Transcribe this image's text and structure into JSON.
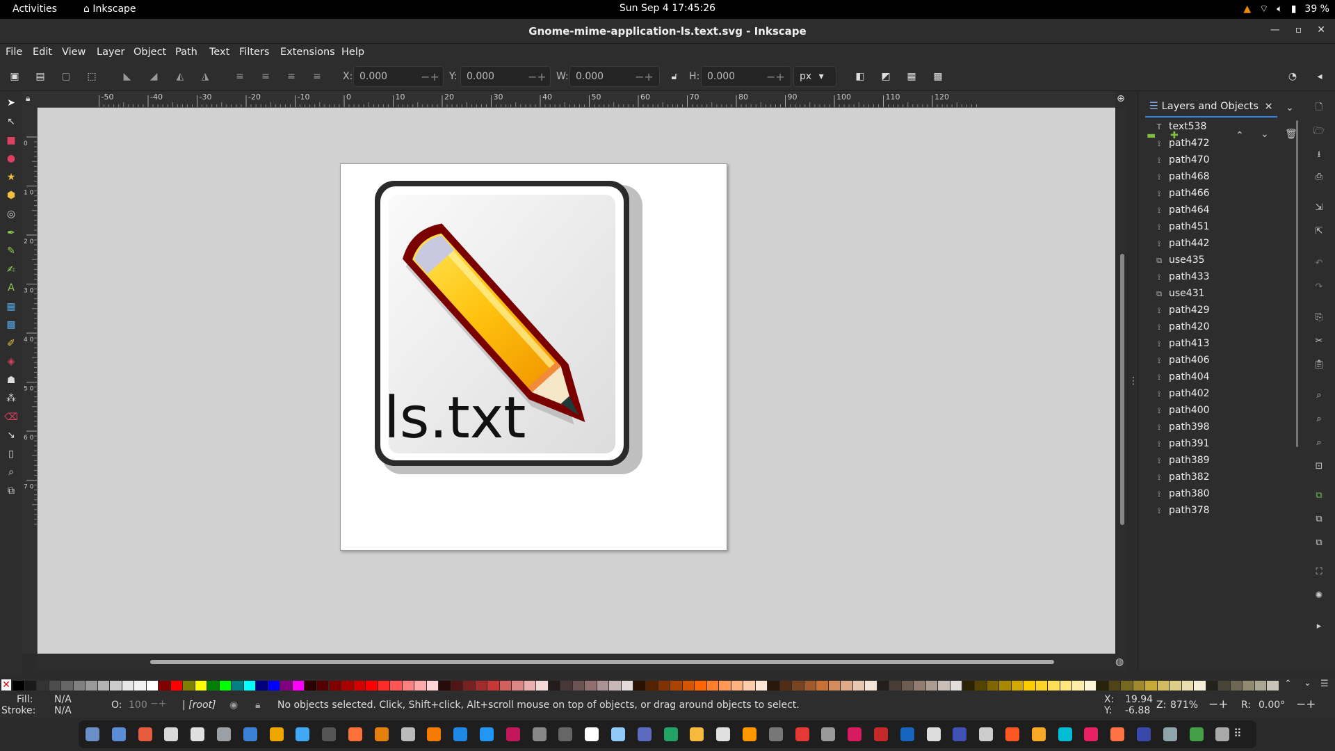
{
  "topbar": {
    "activities": "Activities",
    "app_name": "Inkscape",
    "clock": "Sun Sep 4  17:45:26",
    "battery": "39 %"
  },
  "window": {
    "title": "Gnome-mime-application-ls.text.svg - Inkscape"
  },
  "menu": [
    "File",
    "Edit",
    "View",
    "Layer",
    "Object",
    "Path",
    "Text",
    "Filters",
    "Extensions",
    "Help"
  ],
  "toolbar": {
    "x_label": "X:",
    "x_value": "0.000",
    "y_label": "Y:",
    "y_value": "0.000",
    "w_label": "W:",
    "w_value": "0.000",
    "h_label": "H:",
    "h_value": "0.000",
    "unit": "px"
  },
  "ruler": {
    "h_ticks": [
      "-50",
      "-40",
      "-30",
      "-20",
      "-10",
      "0",
      "10",
      "20",
      "30",
      "40",
      "50",
      "60",
      "70",
      "80",
      "90",
      "100",
      "110",
      "120"
    ],
    "v_ticks": [
      "0",
      "1\n0",
      "2\n0",
      "3\n0",
      "4\n0",
      "5\n0",
      "6\n0",
      "7\n0"
    ]
  },
  "drawing": {
    "text": "ls.txt",
    "colors": {
      "frame": "#2b2b2b",
      "pencil_body": "#ffc20e",
      "pencil_outline": "#7a0000",
      "tip": "#f5e6c8",
      "lead": "#1e3a3a"
    }
  },
  "dock": {
    "tab_label": "Layers and Objects",
    "items": [
      {
        "name": "text538",
        "icon": "text-icon"
      },
      {
        "name": "path472",
        "icon": "path-icon"
      },
      {
        "name": "path470",
        "icon": "path-icon"
      },
      {
        "name": "path468",
        "icon": "path-icon"
      },
      {
        "name": "path466",
        "icon": "path-icon"
      },
      {
        "name": "path464",
        "icon": "path-icon"
      },
      {
        "name": "path451",
        "icon": "path-icon"
      },
      {
        "name": "path442",
        "icon": "path-icon"
      },
      {
        "name": "use435",
        "icon": "clone-icon"
      },
      {
        "name": "path433",
        "icon": "path-icon"
      },
      {
        "name": "use431",
        "icon": "clone-icon"
      },
      {
        "name": "path429",
        "icon": "path-icon"
      },
      {
        "name": "path420",
        "icon": "path-icon"
      },
      {
        "name": "path413",
        "icon": "path-icon"
      },
      {
        "name": "path406",
        "icon": "path-icon"
      },
      {
        "name": "path404",
        "icon": "path-icon"
      },
      {
        "name": "path402",
        "icon": "path-icon"
      },
      {
        "name": "path400",
        "icon": "path-icon"
      },
      {
        "name": "path398",
        "icon": "path-icon"
      },
      {
        "name": "path391",
        "icon": "path-icon"
      },
      {
        "name": "path389",
        "icon": "path-icon"
      },
      {
        "name": "path382",
        "icon": "path-icon"
      },
      {
        "name": "path380",
        "icon": "path-icon"
      },
      {
        "name": "path378",
        "icon": "path-icon"
      }
    ]
  },
  "status": {
    "fill_label": "Fill:",
    "fill_value": "N/A",
    "stroke_label": "Stroke:",
    "stroke_value": "N/A",
    "opacity_label": "O:",
    "opacity_value": "100",
    "layer": "[root]",
    "message": "No objects selected. Click, Shift+click, Alt+scroll mouse on top of objects, or drag around objects to select.",
    "x_label": "X:",
    "x_value": "19.94",
    "y_label": "Y:",
    "y_value": "-6.88",
    "zoom_label": "Z:",
    "zoom_value": "871%",
    "rotate_label": "R:",
    "rotate_value": "0.00°"
  },
  "palette": [
    "#000000",
    "#1a1a1a",
    "#333333",
    "#4d4d4d",
    "#666666",
    "#808080",
    "#999999",
    "#b3b3b3",
    "#cccccc",
    "#e6e6e6",
    "#f2f2f2",
    "#ffffff",
    "#800000",
    "#ff0000",
    "#808000",
    "#ffff00",
    "#008000",
    "#00ff00",
    "#008080",
    "#00ffff",
    "#000080",
    "#0000ff",
    "#800080",
    "#ff00ff",
    "#2b0000",
    "#550000",
    "#800000",
    "#aa0000",
    "#d40000",
    "#ff0000",
    "#ff2a2a",
    "#ff5555",
    "#ff8080",
    "#ffaaaa",
    "#ffd5d5",
    "#280b0b",
    "#501616",
    "#782121",
    "#a02c2c",
    "#c83737",
    "#d35f5f",
    "#de8787",
    "#e9afaf",
    "#f4d7d7",
    "#241c1c",
    "#483737",
    "#6c5353",
    "#916f6f",
    "#ac9393",
    "#c8b7b7",
    "#e3dbdb",
    "#2b1100",
    "#552200",
    "#803300",
    "#aa4400",
    "#d45500",
    "#ff6600",
    "#ff7f2a",
    "#ff9955",
    "#ffb380",
    "#ffccaa",
    "#ffe6d5",
    "#28170b",
    "#502d16",
    "#784421",
    "#a05a2c",
    "#c87137",
    "#d38d5f",
    "#deaa87",
    "#e9c6af",
    "#f4e3d7",
    "#241f1c",
    "#483e37",
    "#6c5d53",
    "#917c6f",
    "#ac9d93",
    "#c8beb7",
    "#e3dedb",
    "#2b2200",
    "#554400",
    "#806600",
    "#aa8800",
    "#d4aa00",
    "#ffcc00",
    "#ffd42a",
    "#ffdd55",
    "#ffe680",
    "#ffeeaa",
    "#fff6d5",
    "#28220b",
    "#504416",
    "#786721",
    "#a0892c",
    "#c8ab37",
    "#d3bc5f",
    "#decd87",
    "#e9ddaf",
    "#f4eed7",
    "#24221c",
    "#484537",
    "#6c6753",
    "#918a6f",
    "#aca793",
    "#c8c4b7"
  ],
  "taskbar_colors": [
    "#6a8fc7",
    "#5b8dd6",
    "#e55b3c",
    "#d9d9d9",
    "#e0e0e0",
    "#9aa0a6",
    "#3b82d6",
    "#f0a500",
    "#3fa9f5",
    "#555555",
    "#ff7139",
    "#e57f0e",
    "#bbbbbb",
    "#f57c00",
    "#1e88e5",
    "#2196f3",
    "#c2185b",
    "#888888",
    "#666666",
    "#ffffff",
    "#90caf9",
    "#5c6bc0",
    "#21a366",
    "#f6b93b",
    "#e0e0e0",
    "#ff9800",
    "#777777",
    "#e53935",
    "#999999",
    "#d81b60",
    "#c62828",
    "#1565c0",
    "#dddddd",
    "#3f51b5",
    "#cccccc",
    "#ff5722",
    "#f9a825",
    "#00bcd4",
    "#e91e63",
    "#ff7043",
    "#3949ab",
    "#90a4ae",
    "#43a047",
    "#aaaaaa"
  ]
}
